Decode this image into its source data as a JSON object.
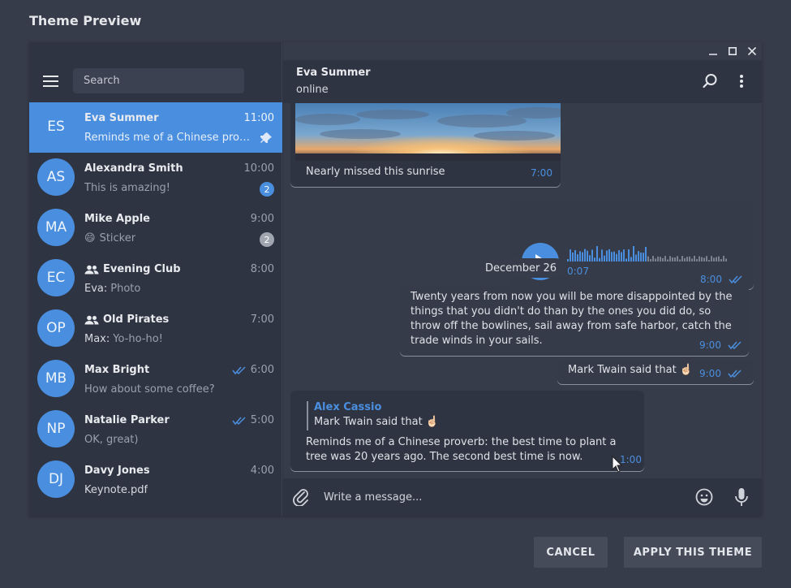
{
  "page": {
    "title": "Theme Preview"
  },
  "search": {
    "placeholder": "Search"
  },
  "chats": [
    {
      "initials": "ES",
      "name": "Eva Summer",
      "time": "11:00",
      "preview": "Reminds me of a Chinese proverb: the best time to plant a tree",
      "active": true,
      "pinned": true
    },
    {
      "initials": "AS",
      "name": "Alexandra Smith",
      "time": "10:00",
      "preview": "This is amazing!",
      "badge": "2"
    },
    {
      "initials": "MA",
      "name": "Mike Apple",
      "time": "9:00",
      "preview_emoji": "😄",
      "preview": "Sticker",
      "badge": "2",
      "badge_muted": true
    },
    {
      "initials": "EC",
      "name": "Evening Club",
      "time": "8:00",
      "group": true,
      "sender": "Eva:",
      "preview": "Photo"
    },
    {
      "initials": "OP",
      "name": "Old Pirates",
      "time": "7:00",
      "group": true,
      "sender": "Max:",
      "preview": "Yo-ho-ho!"
    },
    {
      "initials": "MB",
      "name": "Max Bright",
      "time": "6:00",
      "read": true,
      "preview": "How about some coffee?"
    },
    {
      "initials": "NP",
      "name": "Natalie Parker",
      "time": "5:00",
      "read": true,
      "preview": "OK, great)"
    },
    {
      "initials": "DJ",
      "name": "Davy Jones",
      "time": "4:00",
      "preview": "Keynote.pdf",
      "preview_light": true
    }
  ],
  "conversation": {
    "name": "Eva Summer",
    "status": "online",
    "photo_caption": "Nearly missed this sunrise",
    "photo_time": "7:00",
    "voice_duration": "0:07",
    "voice_time": "8:00",
    "date_separator": "December 26",
    "long_message": "Twenty years from now you will be more disappointed by the things that you didn't do than by the ones you did do, so throw off the bowlines, sail away from safe harbor, catch the trade winds in your sails.",
    "long_time": "9:00",
    "short_message": "Mark Twain said that ☝🏻",
    "short_time": "9:00",
    "reply_name": "Alex Cassio",
    "reply_quote": "Mark Twain said that ☝🏻",
    "reply_message": "Reminds me of a Chinese proverb: the best time to plant a tree was 20 years ago. The second best time is now.",
    "reply_time": "1:00"
  },
  "composer": {
    "placeholder": "Write a message..."
  },
  "buttons": {
    "cancel": "CANCEL",
    "apply": "APPLY THIS THEME"
  },
  "colors": {
    "accent": "#4a8fdf",
    "panel": "#2f3442",
    "background": "#373c4a",
    "muted_badge": "#a0a6b0"
  }
}
